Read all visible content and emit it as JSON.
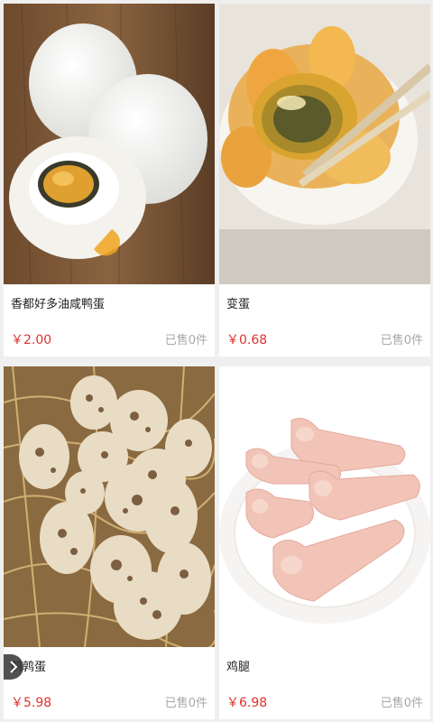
{
  "products": [
    {
      "name": "香都好多油咸鸭蛋",
      "price": "￥2.00",
      "sold": "已售0件",
      "image": "salted-duck-egg-photo"
    },
    {
      "name": "变蛋",
      "price": "￥0.68",
      "sold": "已售0件",
      "image": "century-egg-photo"
    },
    {
      "name": "鹌鹑蛋",
      "price": "￥5.98",
      "sold": "已售0件",
      "image": "quail-egg-photo"
    },
    {
      "name": "鸡腿",
      "price": "￥6.98",
      "sold": "已售0件",
      "image": "chicken-drumstick-photo"
    }
  ],
  "colors": {
    "price": "#e0312e",
    "sold": "#a8a8a8",
    "background": "#efefef"
  }
}
